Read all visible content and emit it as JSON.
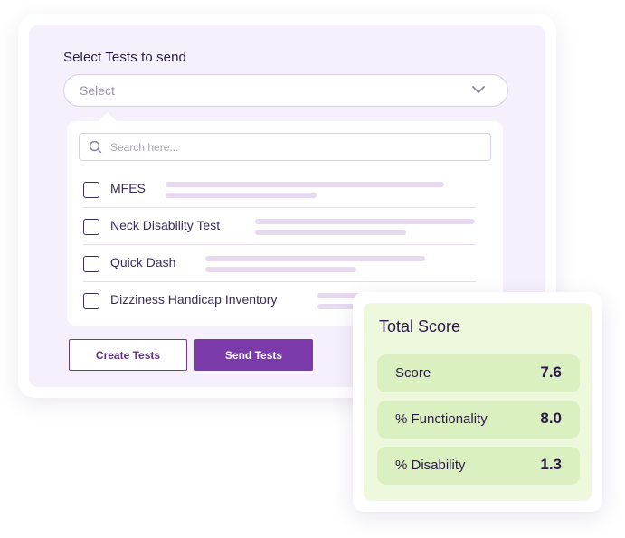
{
  "test_selector": {
    "title": "Select Tests to send",
    "select_placeholder": "Select",
    "search_placeholder": "Search here...",
    "items": [
      {
        "label": "MFES",
        "checked": false
      },
      {
        "label": "Neck Disability Test",
        "checked": false
      },
      {
        "label": "Quick Dash",
        "checked": false
      },
      {
        "label": "Dizziness Handicap Inventory",
        "checked": false
      }
    ],
    "buttons": {
      "create": "Create Tests",
      "send": "Send Tests"
    }
  },
  "total_score": {
    "title": "Total Score",
    "rows": [
      {
        "label": "Score",
        "value": "7.6"
      },
      {
        "label": "% Functionality",
        "value": "8.0"
      },
      {
        "label": "% Disability",
        "value": "1.3"
      }
    ]
  },
  "colors": {
    "accent": "#7a3aa9",
    "panel_bg": "#f5f0fc",
    "score_bg": "#eef8dc",
    "score_row_bg": "#dbf0c0"
  },
  "icons": {
    "dropdown": "chevron-down-icon",
    "search": "search-icon"
  }
}
